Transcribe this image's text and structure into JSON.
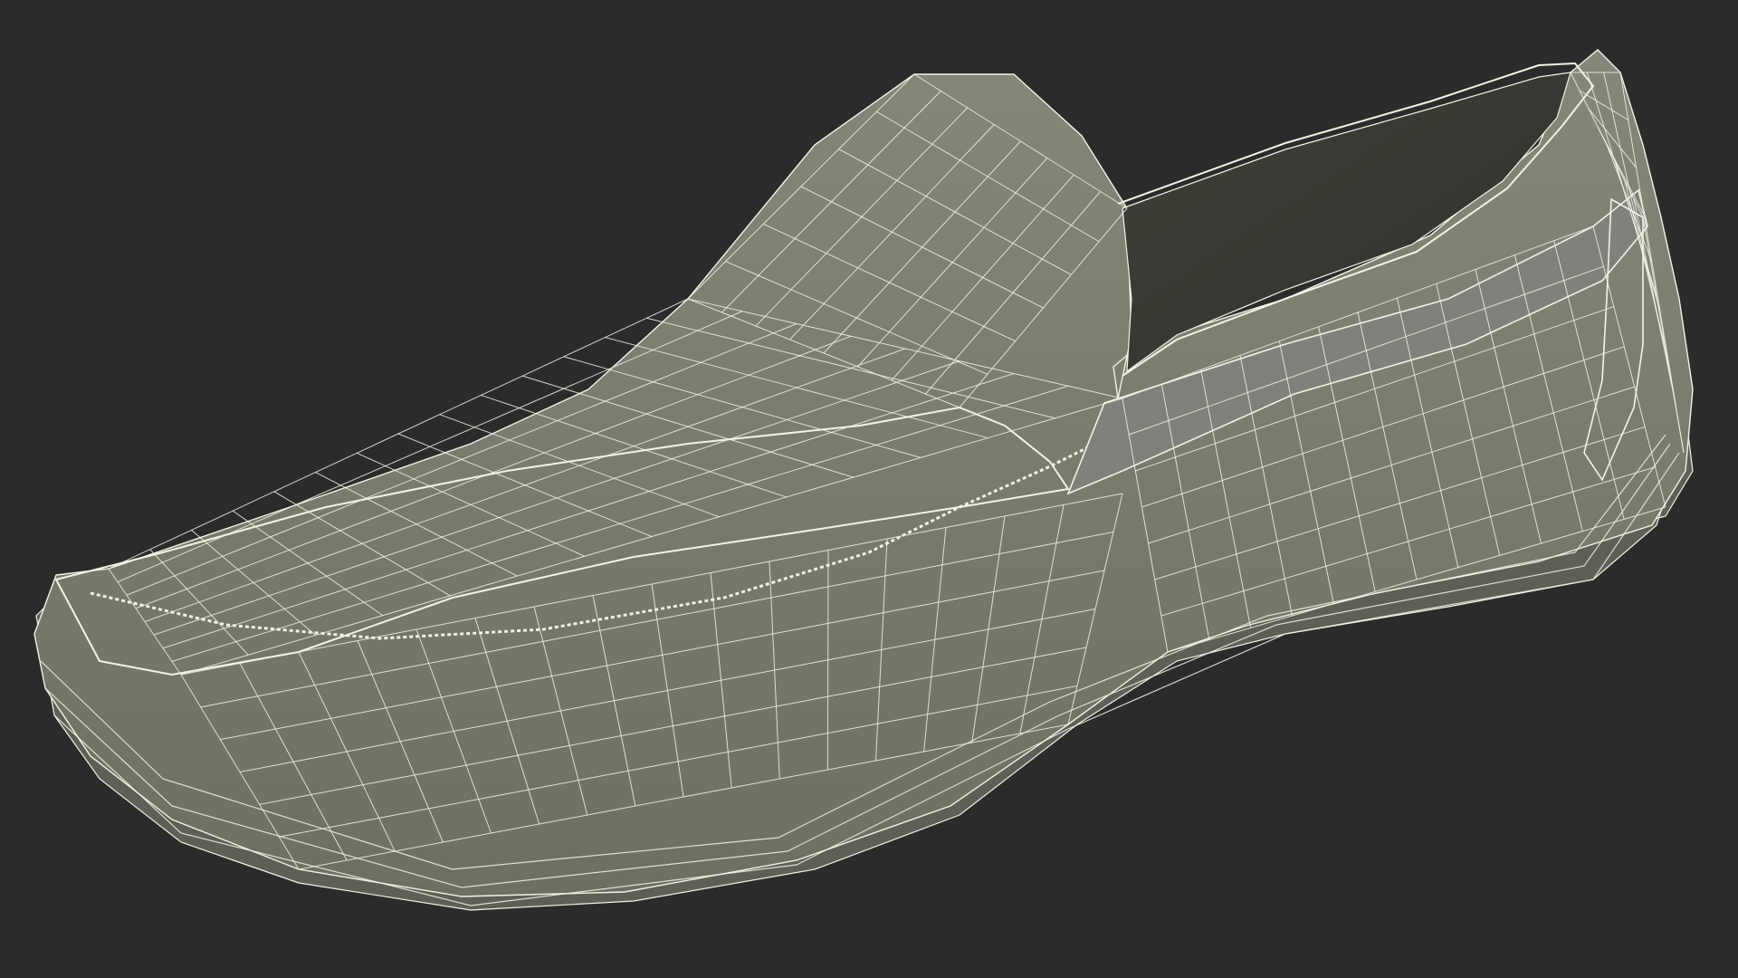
{
  "scene": {
    "background_color": "#2b2b2b",
    "model": {
      "object": "slip-on loafer",
      "render_style": "wireframe-over-shaded",
      "shade_color": "#7b7c6f",
      "shade_dark_color": "#5f6055",
      "interior_color": "#3e4038",
      "interior_deep_color": "#2f312b",
      "wire_color": "#f2f2e6"
    }
  }
}
